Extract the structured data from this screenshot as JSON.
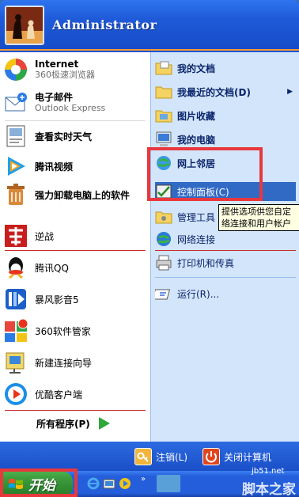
{
  "header": {
    "user_name": "Administrator"
  },
  "pinned": [
    {
      "title": "Internet",
      "subtitle": "360极速浏览器",
      "icon": "360-browser-icon"
    },
    {
      "title": "电子邮件",
      "subtitle": "Outlook Express",
      "icon": "email-icon"
    }
  ],
  "recent": [
    {
      "label": "查看实时天气",
      "icon": "weather-icon"
    },
    {
      "label": "腾讯视频",
      "icon": "tencent-video-icon"
    },
    {
      "label": "强力卸载电脑上的软件",
      "icon": "uninstall-icon"
    },
    {
      "label": "逆战",
      "icon": "nizhan-game-icon"
    },
    {
      "label": "腾讯QQ",
      "icon": "qq-icon"
    },
    {
      "label": "暴风影音5",
      "icon": "baofeng-icon"
    },
    {
      "label": "360软件管家",
      "icon": "360-software-icon"
    },
    {
      "label": "新建连接向导",
      "icon": "connection-wizard-icon"
    },
    {
      "label": "优酷客户端",
      "icon": "youku-icon"
    }
  ],
  "all_programs": "所有程序(P)",
  "places": [
    {
      "label": "我的文档",
      "bold": true,
      "icon": "my-documents-icon"
    },
    {
      "label": "我最近的文档(D)",
      "bold": true,
      "icon": "recent-documents-icon",
      "submenu": true
    },
    {
      "label": "图片收藏",
      "bold": true,
      "icon": "my-pictures-icon"
    },
    {
      "label": "我的电脑",
      "bold": true,
      "icon": "my-computer-icon"
    },
    {
      "label": "网上邻居",
      "bold": true,
      "icon": "network-places-icon"
    },
    {
      "label": "控制面板(C)",
      "bold": false,
      "icon": "control-panel-icon",
      "selected": true
    },
    {
      "label": "管理工具",
      "bold": false,
      "icon": "admin-tools-icon"
    },
    {
      "label": "网络连接",
      "bold": false,
      "icon": "network-connections-icon"
    },
    {
      "label": "打印机和传真",
      "bold": false,
      "icon": "printer-icon"
    },
    {
      "label": "运行(R)...",
      "bold": false,
      "icon": "run-icon"
    }
  ],
  "tooltip": {
    "line1": "提供选项供您自定",
    "line2": "络连接和用户帐户"
  },
  "footer": {
    "logoff": "注销(L)",
    "shutdown": "关闭计算机"
  },
  "taskbar": {
    "start_label": "开始"
  },
  "watermark": {
    "url": "jb51.net",
    "site": "脚本之家"
  },
  "colors": {
    "highlight": "#316ac5",
    "annotation": "#e8383d",
    "start_green": "#3c9a3c"
  }
}
